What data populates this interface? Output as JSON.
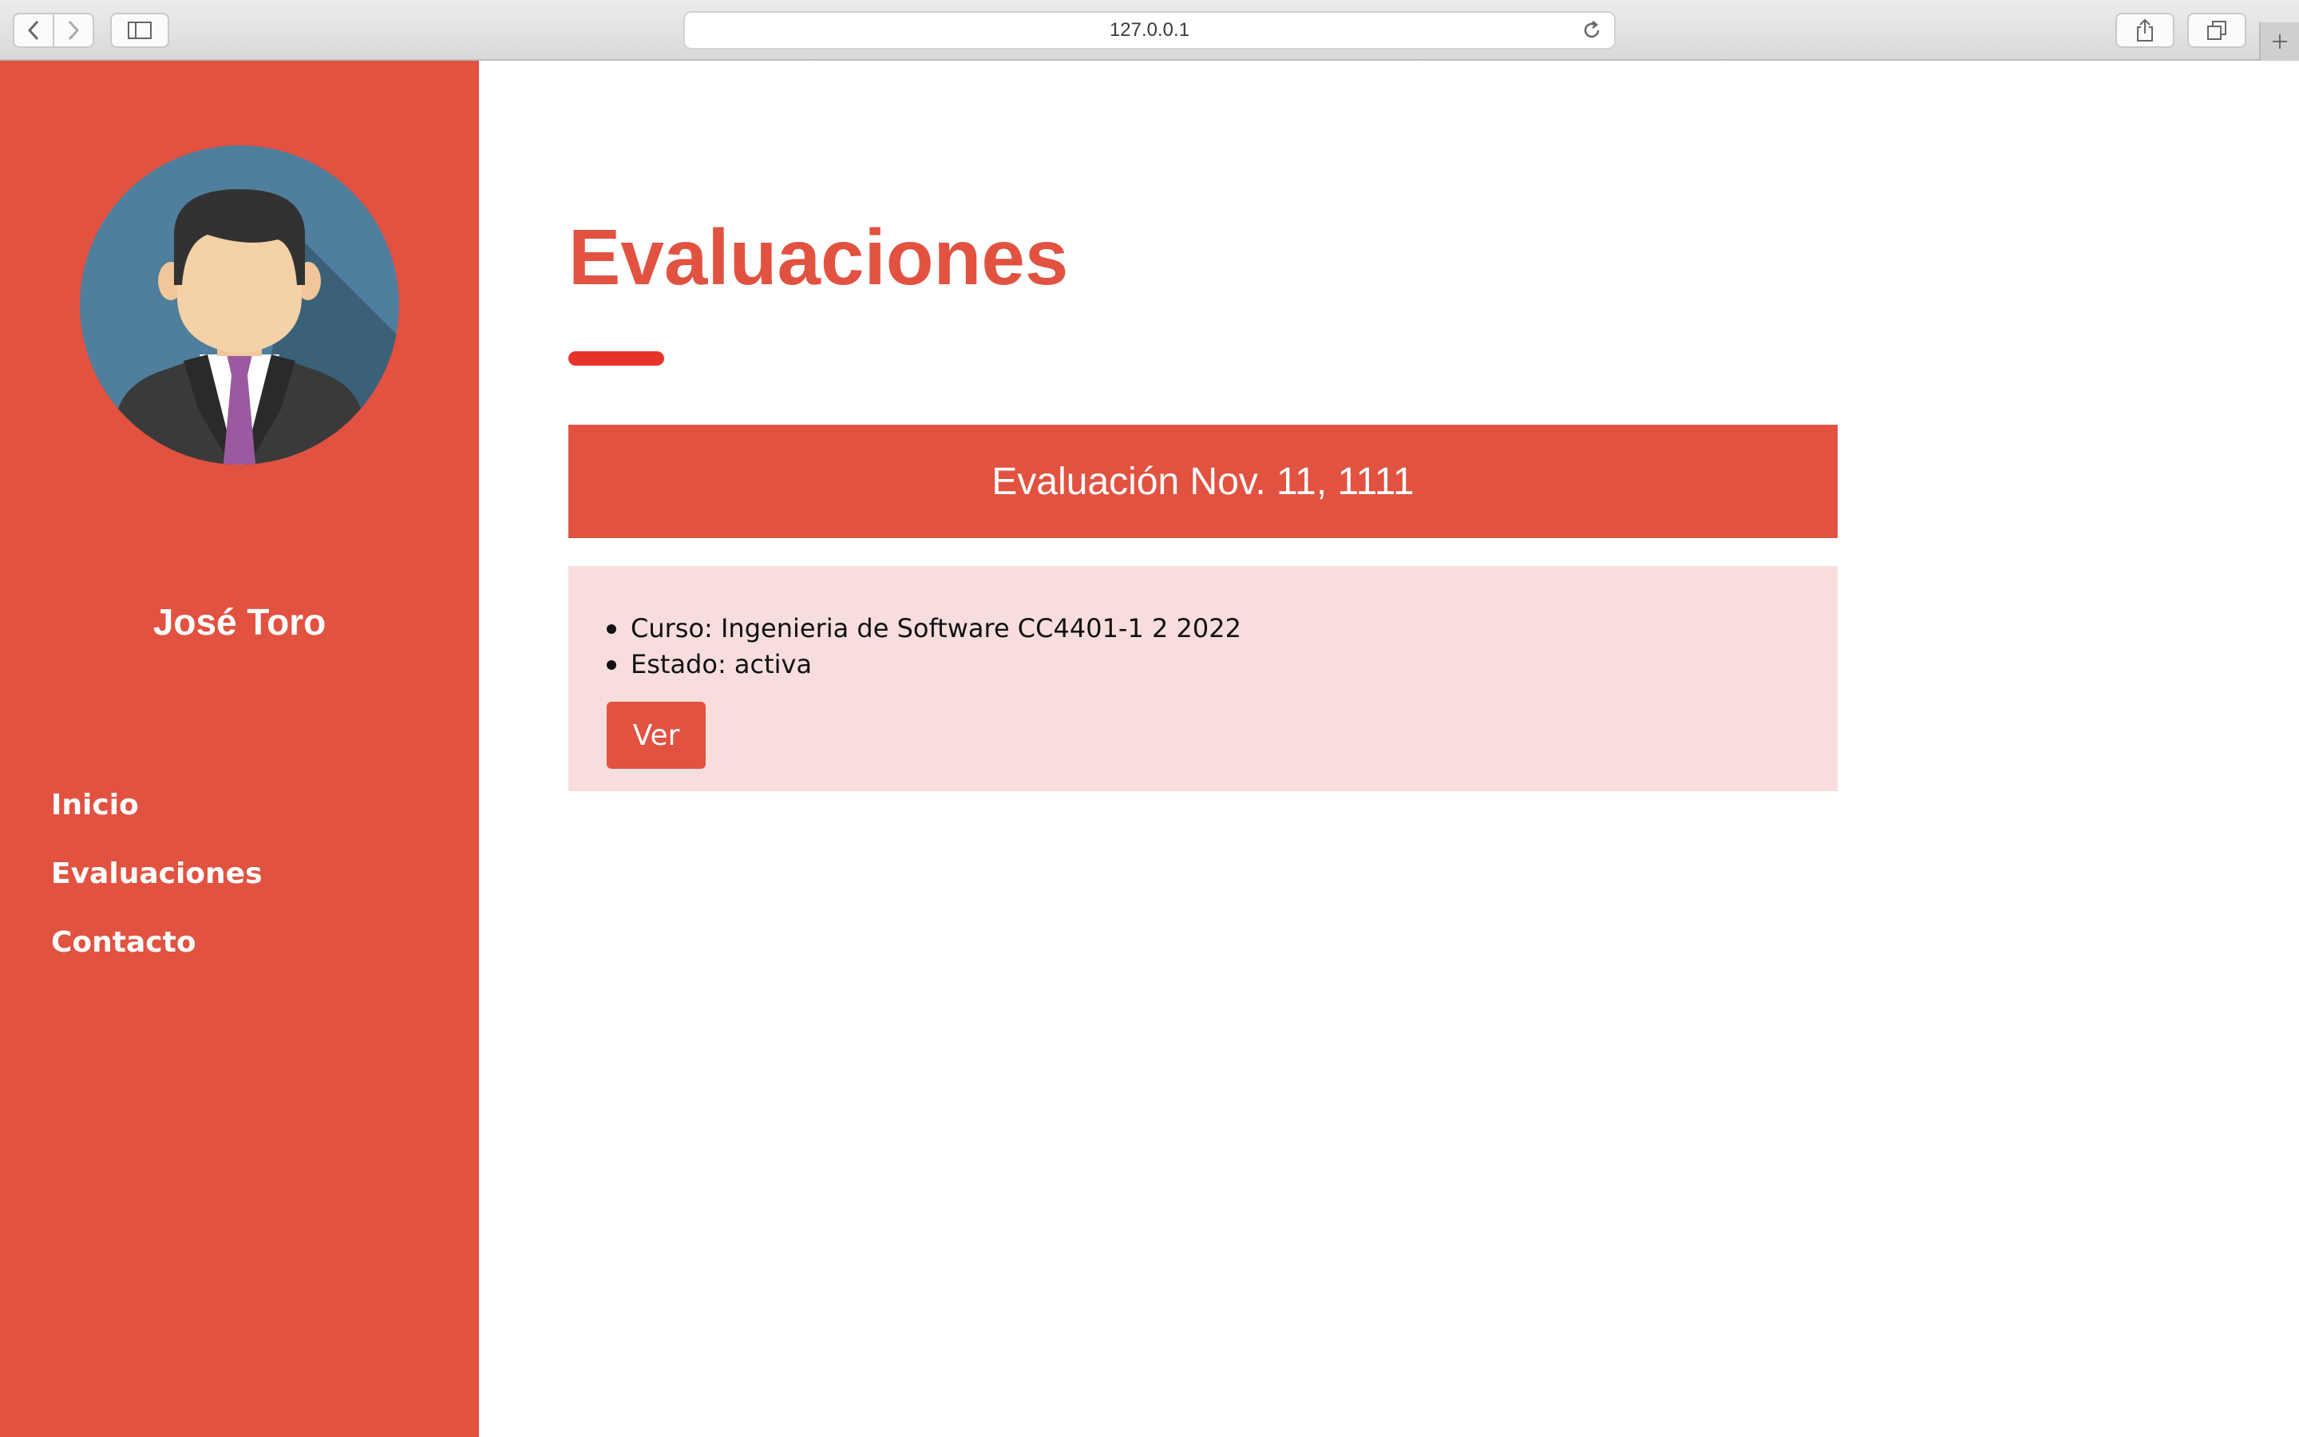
{
  "browser": {
    "url": "127.0.0.1"
  },
  "sidebar": {
    "user_name": "José Toro",
    "nav": [
      {
        "label": "Inicio"
      },
      {
        "label": "Evaluaciones"
      },
      {
        "label": "Contacto"
      }
    ]
  },
  "main": {
    "title": "Evaluaciones",
    "evaluations": [
      {
        "title": "Evaluación Nov. 11, 1111",
        "details": [
          {
            "text": "Curso: Ingenieria de Software CC4401-1 2 2022"
          },
          {
            "text": "Estado: activa"
          }
        ],
        "button_label": "Ver"
      }
    ]
  },
  "colors": {
    "accent": "#e15241",
    "card_body": "#f8dddd",
    "underline": "#e6342a"
  }
}
